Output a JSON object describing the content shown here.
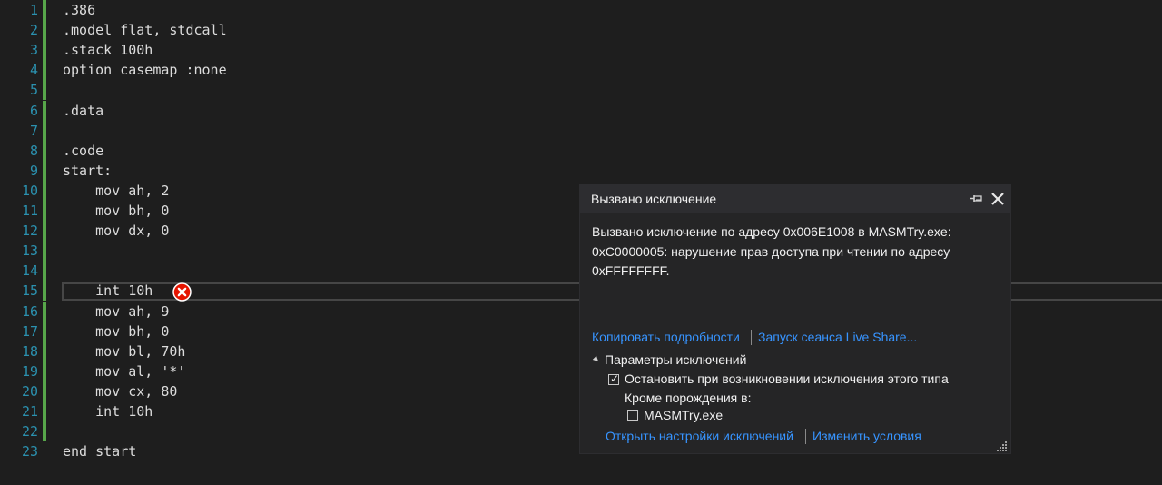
{
  "editor": {
    "lines": [
      {
        "num": "1",
        "text": ".386"
      },
      {
        "num": "2",
        "text": ".model flat, stdcall"
      },
      {
        "num": "3",
        "text": ".stack 100h"
      },
      {
        "num": "4",
        "text": "option casemap :none"
      },
      {
        "num": "5",
        "text": ""
      },
      {
        "num": "6",
        "text": ".data"
      },
      {
        "num": "7",
        "text": ""
      },
      {
        "num": "8",
        "text": ".code"
      },
      {
        "num": "9",
        "text": "start:"
      },
      {
        "num": "10",
        "text": "    mov ah, 2"
      },
      {
        "num": "11",
        "text": "    mov bh, 0"
      },
      {
        "num": "12",
        "text": "    mov dx, 0"
      },
      {
        "num": "13",
        "text": ""
      },
      {
        "num": "14",
        "text": ""
      },
      {
        "num": "15",
        "text": "    int 10h"
      },
      {
        "num": "16",
        "text": "    mov ah, 9"
      },
      {
        "num": "17",
        "text": "    mov bh, 0"
      },
      {
        "num": "18",
        "text": "    mov bl, 70h"
      },
      {
        "num": "19",
        "text": "    mov al, '*'"
      },
      {
        "num": "20",
        "text": "    mov cx, 80"
      },
      {
        "num": "21",
        "text": "    int 10h"
      },
      {
        "num": "22",
        "text": ""
      },
      {
        "num": "23",
        "text": "end start"
      }
    ],
    "error_icon": "error-circle-icon",
    "colors": {
      "line_number": "#2b91af",
      "change_marker": "#57a64a",
      "text": "#dcdcdc",
      "background": "#1e1e1e"
    }
  },
  "exception_popup": {
    "title": "Вызвано исключение",
    "message_line1": "Вызвано исключение по адресу 0x006E1008 в MASMTry.exe:",
    "message_line2": "0xC0000005: нарушение прав доступа при чтении по адресу",
    "message_line3": "0xFFFFFFFF.",
    "link_copy_details": "Копировать подробности",
    "link_live_share": "Запуск сеанса Live Share...",
    "section_title": "Параметры исключений",
    "checkbox_break_label": "Остановить при возникновении исключения этого типа",
    "checkbox_break_checked": true,
    "except_when_label": "Кроме порождения в:",
    "checkbox_module_label": "MASMTry.exe",
    "checkbox_module_checked": false,
    "link_open_settings": "Открыть настройки исключений",
    "link_edit_conditions": "Изменить условия",
    "icons": [
      "pin-icon",
      "close-icon",
      "resize-grip-icon"
    ],
    "colors": {
      "link": "#3794ff",
      "background": "#252526",
      "header": "#2d2d30"
    }
  }
}
